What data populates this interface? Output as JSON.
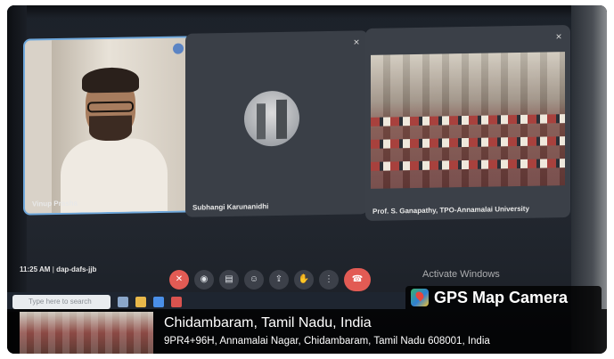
{
  "participants": [
    {
      "name": "Vinup Prasha",
      "status": "speaking"
    },
    {
      "name": "Subhangi Karunanidhi",
      "status": "muted"
    },
    {
      "name": "Prof. S. Ganapathy, TPO-Annamalai University",
      "status": "muted"
    }
  ],
  "meeting": {
    "time": "11:25 AM",
    "code": "dap-dafs-jjb"
  },
  "controls": [
    {
      "name": "mic-off-icon",
      "glyph": "✕"
    },
    {
      "name": "camera-icon",
      "glyph": "◉"
    },
    {
      "name": "captions-icon",
      "glyph": "▤"
    },
    {
      "name": "emoji-icon",
      "glyph": "☺"
    },
    {
      "name": "present-icon",
      "glyph": "⇪"
    },
    {
      "name": "raise-hand-icon",
      "glyph": "✋"
    },
    {
      "name": "more-options-icon",
      "glyph": "⋮"
    },
    {
      "name": "end-call-icon",
      "glyph": "☎"
    }
  ],
  "watermark": "Activate Windows",
  "taskbar": {
    "search_placeholder": "Type here to search"
  },
  "gps": {
    "app_title": "GPS Map Camera",
    "city": "Chidambaram, Tamil Nadu, India",
    "address": "9PR4+96H, Annamalai Nagar, Chidambaram, Tamil Nadu 608001, India"
  },
  "colors": {
    "end_call": "#e25b54",
    "active_border": "#6fa8dc"
  }
}
